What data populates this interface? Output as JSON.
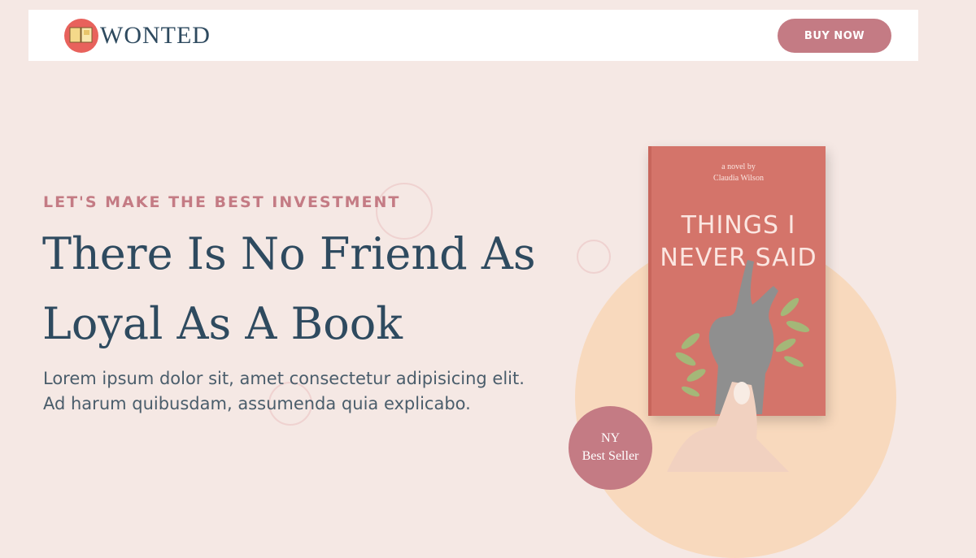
{
  "header": {
    "logo_text": "WONTED",
    "buy_button": "BUY NOW"
  },
  "hero": {
    "tagline": "LET'S MAKE THE BEST INVESTMENT",
    "headline": "There Is No Friend As Loyal As A Book",
    "description": "Lorem ipsum dolor sit, amet consectetur adipisicing elit. Ad harum quibusdam, assumenda quia explicabo."
  },
  "book": {
    "byline_1": "a novel by",
    "byline_2": "Claudia Wilson",
    "title": "THINGS I NEVER SAID"
  },
  "badge": {
    "line_1": "NY",
    "line_2": "Best Seller"
  },
  "colors": {
    "background": "#f5e8e4",
    "accent": "#c47b84",
    "heading": "#2e4a5f",
    "book_cover": "#d4746a",
    "circle": "#f8d9bd"
  }
}
